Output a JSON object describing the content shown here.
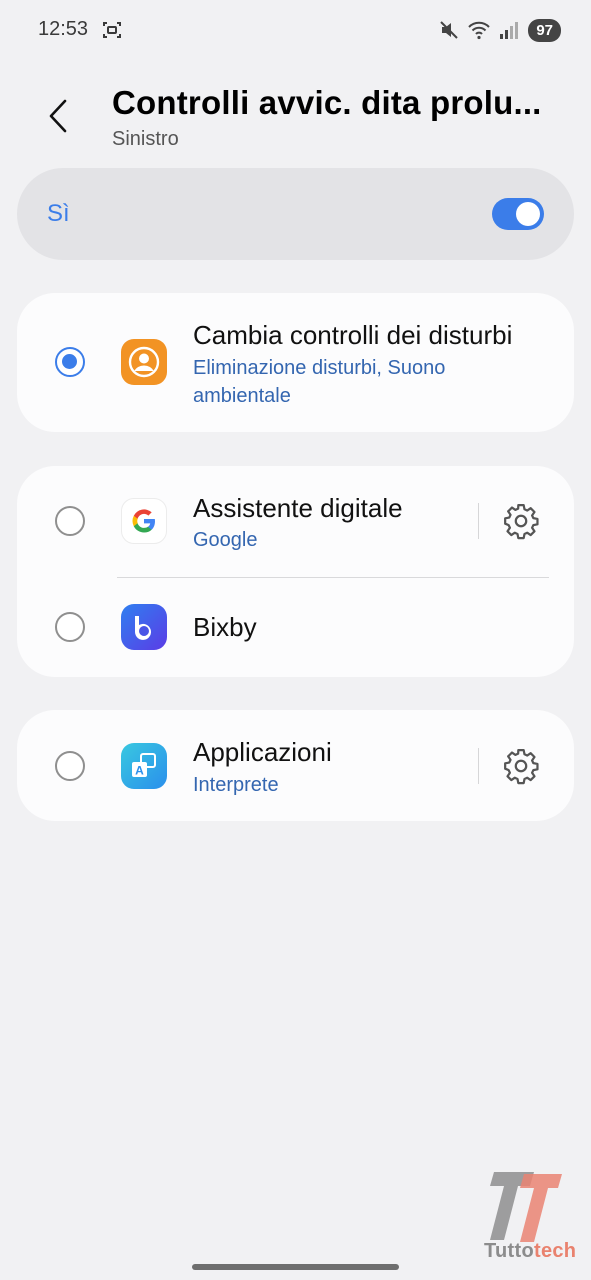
{
  "status_bar": {
    "time": "12:53",
    "battery": "97",
    "icons": [
      "screen-capture-icon",
      "mute-icon",
      "wifi-icon",
      "signal-icon"
    ]
  },
  "header": {
    "title": "Controlli avvic. dita prolu...",
    "subtitle": "Sinistro"
  },
  "master_switch": {
    "label": "Sì",
    "on": true,
    "accent": "#3b7de9"
  },
  "options": [
    {
      "title": "Cambia controlli dei disturbi",
      "subtitle": "Eliminazione disturbi, Suono ambientale",
      "selected": true,
      "icon": "noise-control-icon",
      "icon_color": "#f29324"
    },
    {
      "title": "Assistente digitale",
      "subtitle": "Google",
      "selected": false,
      "icon": "google-icon",
      "has_settings": true
    },
    {
      "title": "Bixby",
      "selected": false,
      "icon": "bixby-icon",
      "icon_color": "#4a54e6"
    },
    {
      "title": "Applicazioni",
      "subtitle": "Interprete",
      "selected": false,
      "icon": "interpreter-icon",
      "icon_color": "#2ba6e8",
      "has_settings": true
    }
  ],
  "watermark": {
    "text_before": "Tutto",
    "text_accent": "tech"
  }
}
